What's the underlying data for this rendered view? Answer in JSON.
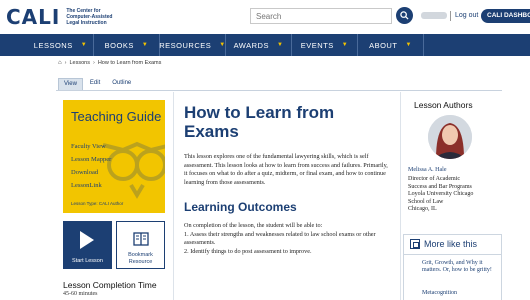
{
  "header": {
    "logo_text": "CALI",
    "logo_subtitle": "The Center for Computer-Assisted Legal Instruction",
    "search_placeholder": "Search",
    "logout_label": "Log out",
    "dashboard_label": "CALI DASHBOARD"
  },
  "nav": {
    "items": [
      {
        "label": "LESSONS"
      },
      {
        "label": "BOOKS"
      },
      {
        "label": "RESOURCES"
      },
      {
        "label": "AWARDS"
      },
      {
        "label": "EVENTS"
      },
      {
        "label": "ABOUT"
      }
    ]
  },
  "breadcrumb": {
    "items": [
      "Lessons",
      "How to Learn from Exams"
    ]
  },
  "tabs": [
    {
      "label": "View",
      "active": true
    },
    {
      "label": "Edit",
      "active": false
    },
    {
      "label": "Outline",
      "active": false
    }
  ],
  "teaching_guide": {
    "title": "Teaching Guide",
    "links": [
      "Faculty View",
      "Lesson Mapper",
      "Download",
      "LessonLink"
    ],
    "lesson_type": "Lesson Type: CALI Author"
  },
  "actions": {
    "start_label": "Start Lesson",
    "bookmark_label": "Bookmark Resource"
  },
  "completion": {
    "heading": "Lesson Completion Time",
    "value": "45-60 minutes"
  },
  "lesson": {
    "title": "How to Learn from Exams",
    "description": "This lesson explores one of the fundamental lawyering skills, which is self assessment. This lesson looks at how to learn from success and failures. Primarily, it focuses on what to do after a quiz, midterm, or final exam, and how to continue learning from those assessments.",
    "outcomes_heading": "Learning Outcomes",
    "outcomes_intro": "On completion of the lesson, the student will be able to:",
    "outcomes": [
      "1. Assess their strengths and weaknesses related to law school exams or other assessments.",
      "2. Identify things to do post assessment to improve."
    ]
  },
  "authors": {
    "heading": "Lesson Authors",
    "name": "Melissa A. Hale",
    "info": [
      "Director of Academic",
      "Success and Bar Programs",
      "Loyola University Chicago",
      "School of Law",
      "Chicago, IL"
    ]
  },
  "more_like_this": {
    "heading": "More like this",
    "items": [
      "Grit, Growth, and Why it matters. Or, how to be gritty!",
      "Metacognition"
    ]
  },
  "colors": {
    "brand_navy": "#1c3f73",
    "guide_yellow": "#f2c500",
    "caret_yellow": "#f2c200"
  }
}
